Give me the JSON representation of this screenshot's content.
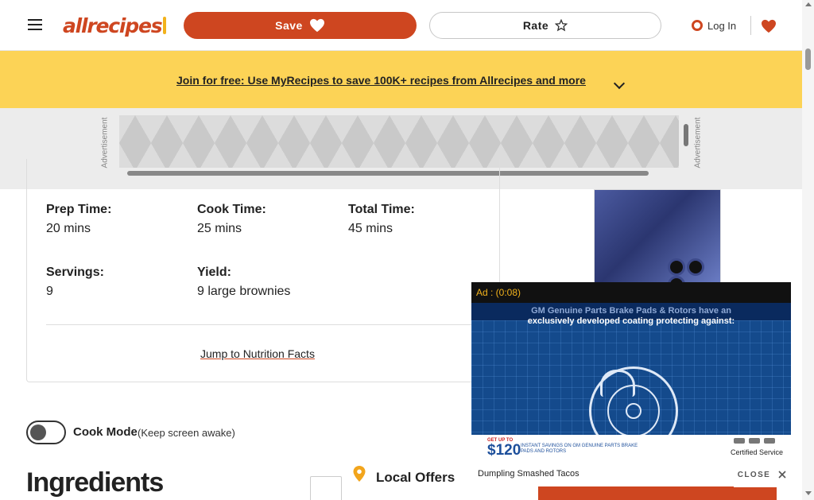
{
  "header": {
    "logo_text": "allrecipes",
    "save_label": "Save",
    "rate_label": "Rate",
    "login_label": "Log In"
  },
  "promo": {
    "link_text": "Join for free: Use MyRecipes to save 100K+ recipes from Allrecipes and more"
  },
  "ad_strip": {
    "label": "Advertisement"
  },
  "details": {
    "items": [
      {
        "label": "Prep Time:",
        "value": "20 mins"
      },
      {
        "label": "Cook Time:",
        "value": "25 mins"
      },
      {
        "label": "Total Time:",
        "value": "45 mins"
      },
      {
        "label": "Servings:",
        "value": "9"
      },
      {
        "label": "Yield:",
        "value": "9 large brownies"
      }
    ],
    "jump_link": "Jump to Nutrition Facts"
  },
  "cook_mode": {
    "label": "Cook Mode",
    "sublabel": "(Keep screen awake)",
    "enabled": false
  },
  "ingredients": {
    "heading": "Ingredients"
  },
  "local_offers": {
    "heading": "Local Offers"
  },
  "video_ad": {
    "timer": "Ad : (0:08)",
    "headline_top": "GM Genuine Parts Brake Pads & Rotors have an",
    "headline": "exclusively developed coating protecting against:",
    "price_prefix": "GET UP TO",
    "price": "$120",
    "price_text": "INSTANT SAVINGS ON GM GENUINE PARTS BRAKE PADS AND ROTORS",
    "certified_text": "Certified Service",
    "caption": "Dumpling Smashed Tacos",
    "close_label": "CLOSE"
  },
  "colors": {
    "brand": "#ce4620",
    "promo_bg": "#fcd356"
  },
  "icons": [
    "hamburger-icon",
    "heart-icon",
    "star-icon",
    "user-icon",
    "pin-icon",
    "close-icon"
  ]
}
